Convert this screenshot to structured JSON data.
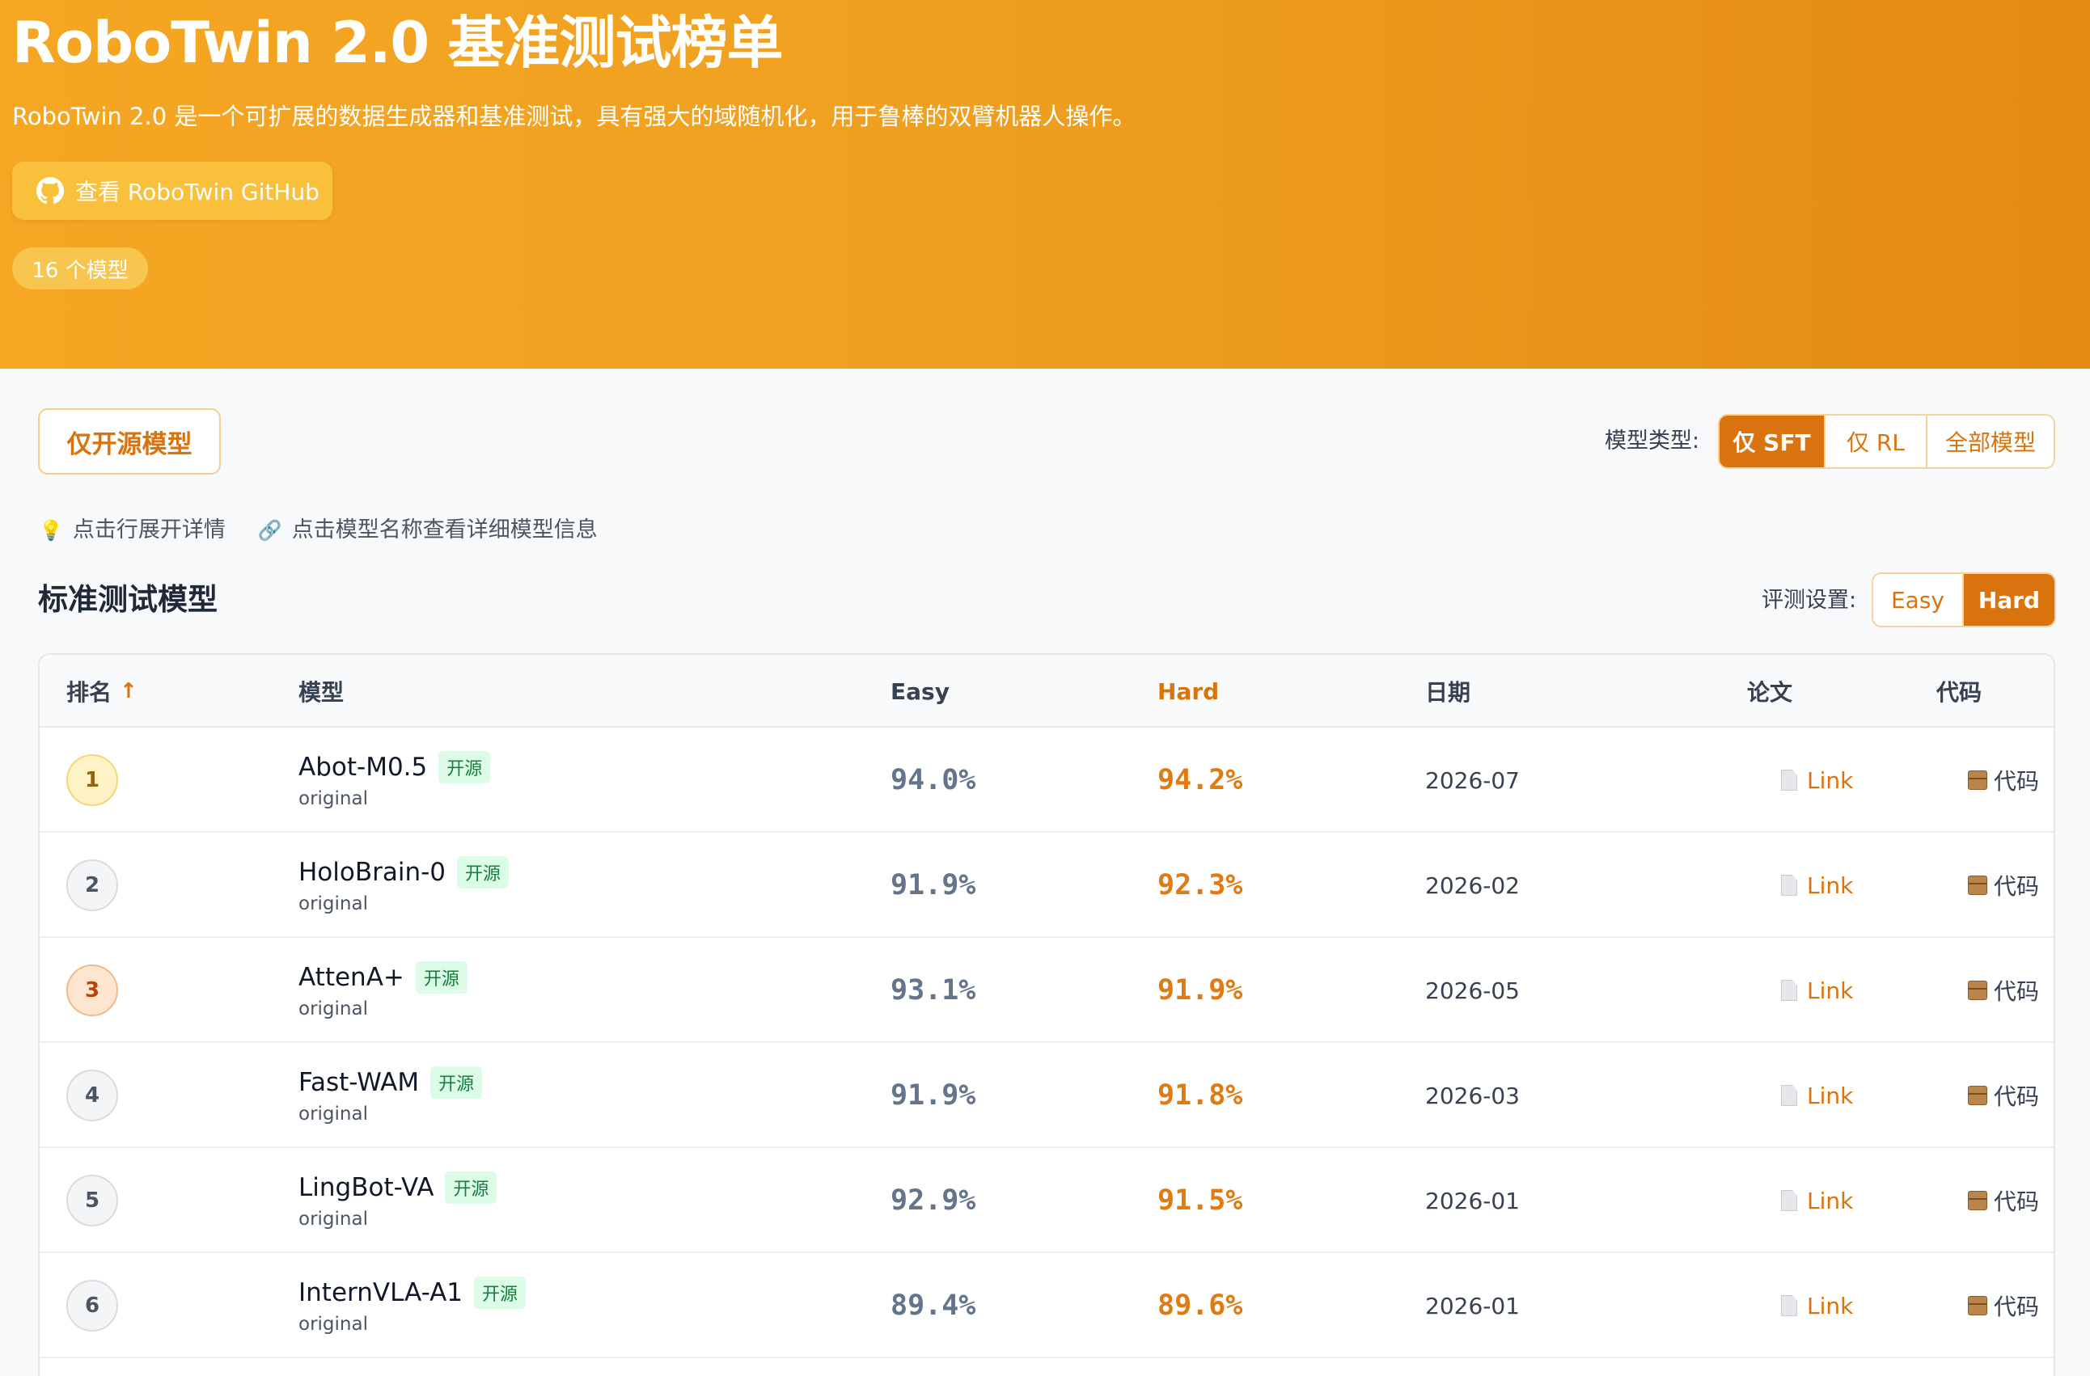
{
  "hero": {
    "title": "RoboTwin 2.0 基准测试榜单",
    "subtitle": "RoboTwin 2.0 是一个可扩展的数据生成器和基准测试，具有强大的域随机化，用于鲁棒的双臂机器人操作。",
    "github_button": "查看 RoboTwin GitHub",
    "model_count": "16 个模型"
  },
  "filters": {
    "open_source_only": "仅开源模型",
    "model_type_label": "模型类型:",
    "model_type_options": [
      "仅 SFT",
      "仅 RL",
      "全部模型"
    ],
    "model_type_selected": "仅 SFT"
  },
  "hints": {
    "expand": "点击行展开详情",
    "model_info": "点击模型名称查看详细模型信息"
  },
  "section": {
    "title": "标准测试模型",
    "eval_label": "评测设置:",
    "eval_options": [
      "Easy",
      "Hard"
    ],
    "eval_selected": "Hard"
  },
  "table": {
    "headers": {
      "rank": "排名",
      "sort_indicator": "↑",
      "model": "模型",
      "easy": "Easy",
      "hard": "Hard",
      "date": "日期",
      "paper": "论文",
      "code": "代码"
    },
    "rows": [
      {
        "rank": "1",
        "model": "Abot-M0.5",
        "tag": "开源",
        "variant": "original",
        "easy": "94.0%",
        "hard": "94.2%",
        "date": "2026-07",
        "paper": "Link",
        "code": "代码"
      },
      {
        "rank": "2",
        "model": "HoloBrain-0",
        "tag": "开源",
        "variant": "original",
        "easy": "91.9%",
        "hard": "92.3%",
        "date": "2026-02",
        "paper": "Link",
        "code": "代码"
      },
      {
        "rank": "3",
        "model": "AttenA+",
        "tag": "开源",
        "variant": "original",
        "easy": "93.1%",
        "hard": "91.9%",
        "date": "2026-05",
        "paper": "Link",
        "code": "代码"
      },
      {
        "rank": "4",
        "model": "Fast-WAM",
        "tag": "开源",
        "variant": "original",
        "easy": "91.9%",
        "hard": "91.8%",
        "date": "2026-03",
        "paper": "Link",
        "code": "代码"
      },
      {
        "rank": "5",
        "model": "LingBot-VA",
        "tag": "开源",
        "variant": "original",
        "easy": "92.9%",
        "hard": "91.5%",
        "date": "2026-01",
        "paper": "Link",
        "code": "代码"
      },
      {
        "rank": "6",
        "model": "InternVLA-A1",
        "tag": "开源",
        "variant": "original",
        "easy": "89.4%",
        "hard": "89.6%",
        "date": "2026-01",
        "paper": "Link",
        "code": "代码"
      }
    ]
  },
  "colors": {
    "accent": "#d9730d",
    "hero_start": "#f5a623",
    "hero_end": "#e48a12",
    "open_source_tag": "#15803d",
    "hard_score": "#e07b12",
    "easy_score": "#64748b"
  },
  "icons": {
    "github": "github-icon",
    "hint_expand": "lightbulb-icon",
    "hint_model_info": "link-icon",
    "paper": "document-icon",
    "code": "package-icon"
  }
}
